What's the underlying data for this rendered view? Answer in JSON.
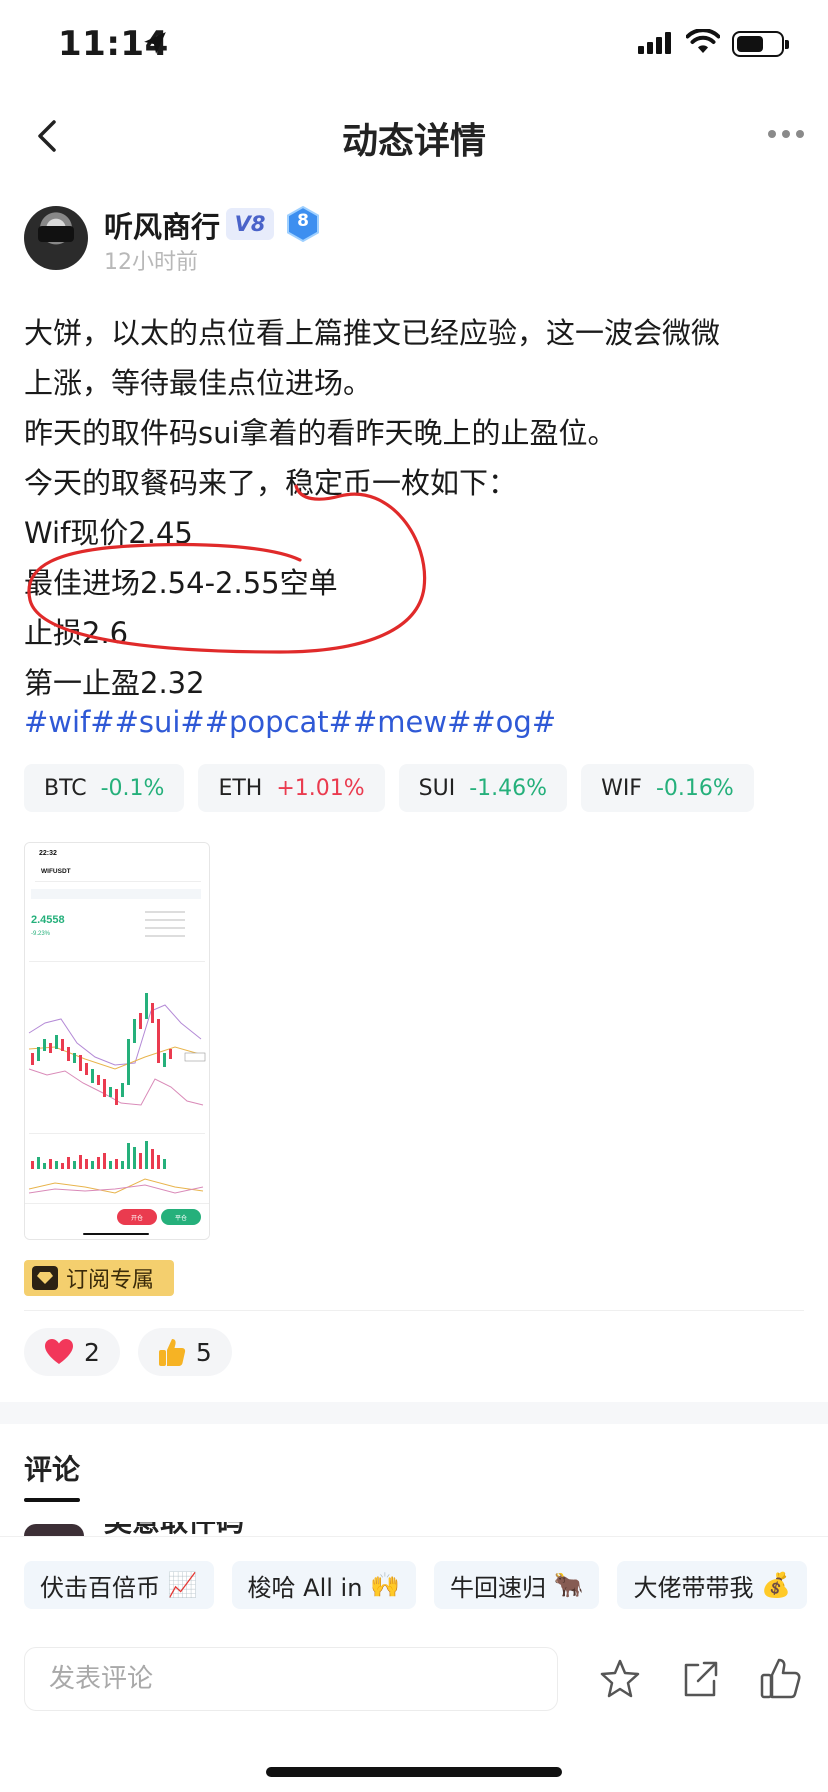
{
  "status_bar": {
    "time": "11:14"
  },
  "nav": {
    "title": "动态详情"
  },
  "author": {
    "name": "听风商行",
    "vip": "V8",
    "level": "8",
    "time": "12小时前"
  },
  "post": {
    "lines": [
      "大饼，以太的点位看上篇推文已经应验，这一波会微微",
      "上涨，等待最佳点位进场。",
      "昨天的取件码sui拿着的看昨天晚上的止盈位。",
      "今天的取餐码来了，稳定币一枚如下：",
      "Wif现价2.45",
      "最佳进场2.54-2.55空单",
      "止损2.6",
      "第一止盈2.32"
    ],
    "tags": "#wif##sui##popcat##mew##og#"
  },
  "tickers": [
    {
      "symbol": "BTC",
      "change": "-0.1%",
      "direction": "down"
    },
    {
      "symbol": "ETH",
      "change": "+1.01%",
      "direction": "up"
    },
    {
      "symbol": "SUI",
      "change": "-1.46%",
      "direction": "down"
    },
    {
      "symbol": "WIF",
      "change": "-0.16%",
      "direction": "down"
    }
  ],
  "thumbnail": {
    "time": "22:32",
    "pair": "WIFUSDT",
    "price": "2.4558",
    "change": "-9.23%",
    "buy": "开仓",
    "sell": "平仓"
  },
  "subscribe": {
    "label": "订阅专属"
  },
  "reactions": [
    {
      "icon": "heart-icon",
      "count": "2"
    },
    {
      "icon": "thumbs-up-icon",
      "count": "5"
    }
  ],
  "comments": {
    "title": "评论",
    "peek_name": "吴意取件码"
  },
  "quick_replies": [
    {
      "label": "伏击百倍币",
      "emoji": "📈"
    },
    {
      "label": "梭哈 All in",
      "emoji": "🙌"
    },
    {
      "label": "牛回速归",
      "emoji": "🐂"
    },
    {
      "label": "大佬带带我",
      "emoji": "💰"
    }
  ],
  "composer": {
    "placeholder": "发表评论"
  },
  "colors": {
    "accent_blue": "#2f59d6",
    "up": "#ea3b4f",
    "down": "#25b07b",
    "annotation": "#e02a2a"
  }
}
